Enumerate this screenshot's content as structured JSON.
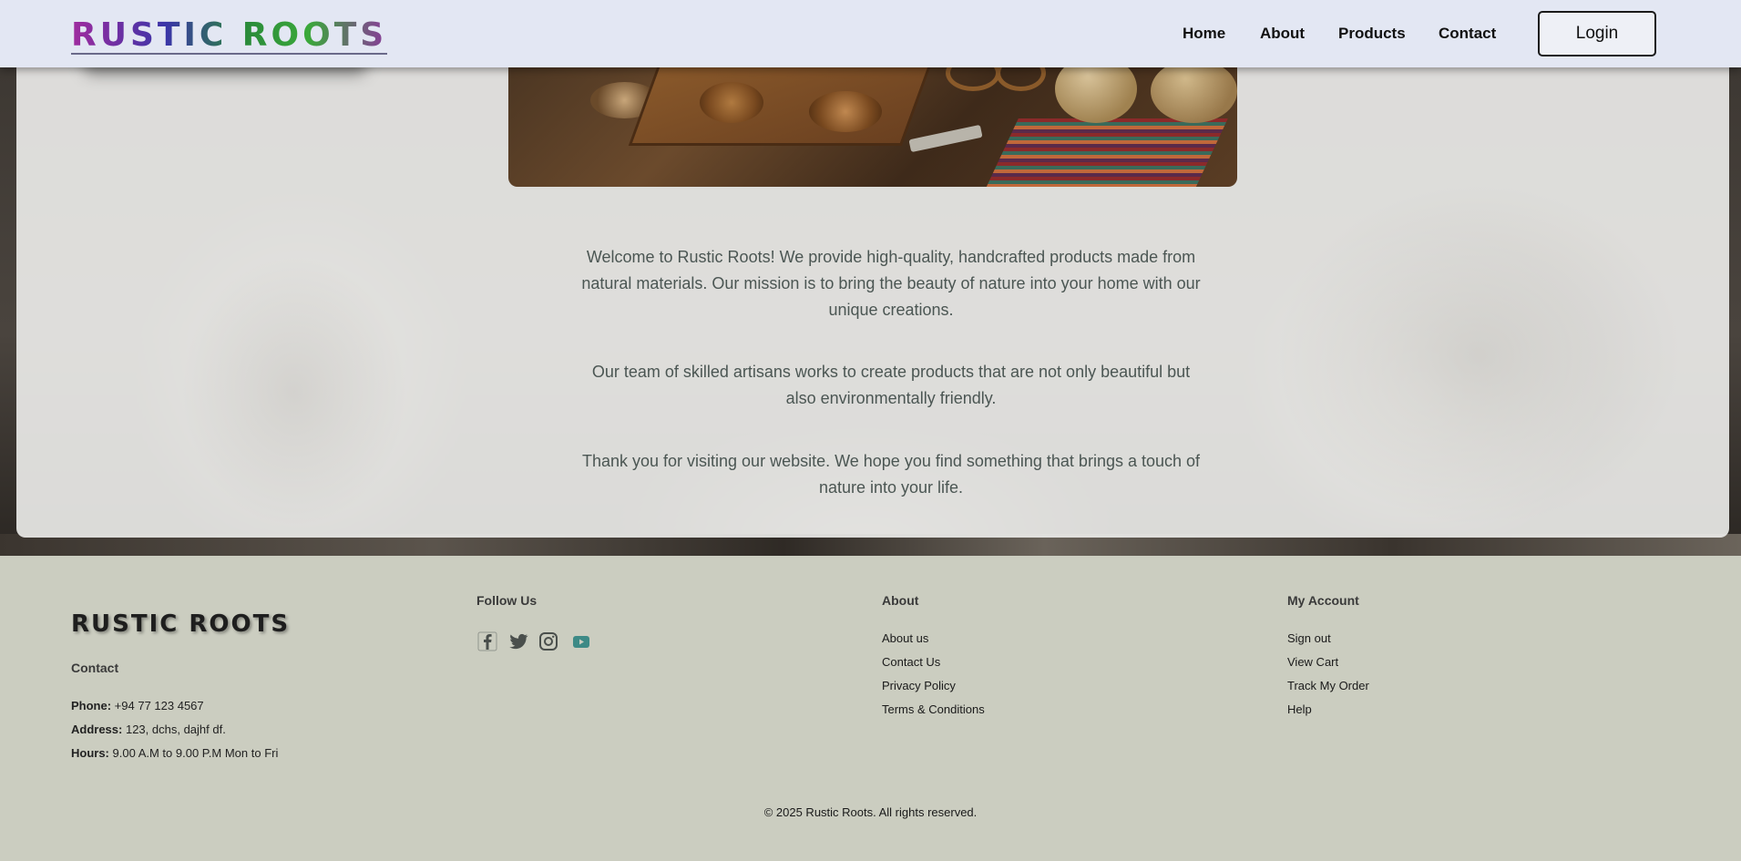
{
  "header": {
    "logo": "RUSTIC ROOTS",
    "nav": [
      "Home",
      "About",
      "Products",
      "Contact"
    ],
    "login_label": "Login"
  },
  "main": {
    "paragraphs": [
      "Welcome to Rustic Roots! We provide high-quality, handcrafted products made from natural materials. Our mission is to bring the beauty of nature into your home with our unique creations.",
      "Our team of skilled artisans works to create products that are not only beautiful but also environmentally friendly.",
      "Thank you for visiting our website. We hope you find something that brings a touch of nature into your life."
    ]
  },
  "footer": {
    "logo": "RUSTIC ROOTS",
    "contact_heading": "Contact",
    "phone_label": "Phone:",
    "phone": " +94 77 123 4567",
    "address_label": "Address:",
    "address": " 123, dchs, dajhf df.",
    "hours_label": "Hours:",
    "hours": " 9.00 A.M to 9.00 P.M Mon to Fri",
    "follow_heading": "Follow Us",
    "social_icons": [
      "facebook-icon",
      "twitter-icon",
      "instagram-icon",
      "youtube-icon"
    ],
    "about_heading": "About",
    "about_links": [
      "About us",
      "Contact Us",
      "Privacy Policy",
      "Terms & Conditions"
    ],
    "account_heading": "My Account",
    "account_links": [
      "Sign out",
      "View Cart",
      "Track My Order",
      "Help"
    ],
    "copyright": "© 2025 Rustic Roots. All rights reserved."
  },
  "colors": {
    "header_bg": "#e3e7f3",
    "footer_bg": "#cbcdc0",
    "body_text": "#4b5653",
    "social_accent": "#3d8a86"
  }
}
